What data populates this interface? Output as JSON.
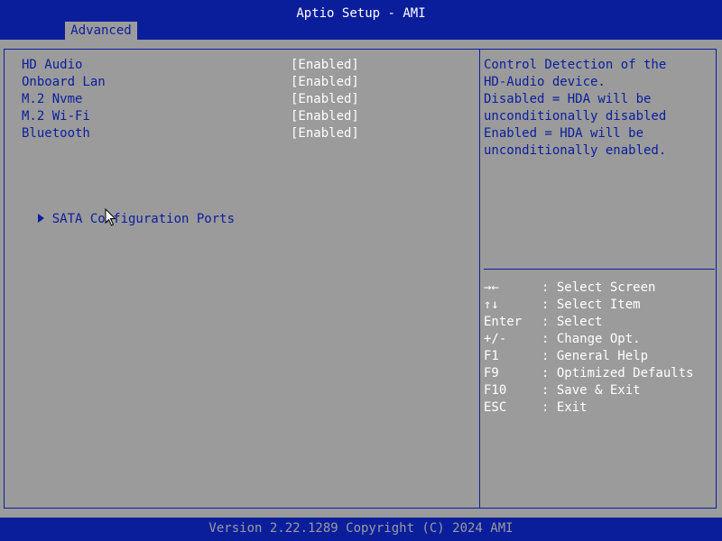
{
  "app_title": "Aptio Setup - AMI",
  "tabs": [
    {
      "label": "Advanced",
      "active": true
    }
  ],
  "settings": [
    {
      "label": "HD Audio",
      "value": "[Enabled]"
    },
    {
      "label": "Onboard Lan",
      "value": "[Enabled]"
    },
    {
      "label": "M.2 Nvme",
      "value": "[Enabled]"
    },
    {
      "label": "M.2 Wi-Fi",
      "value": "[Enabled]"
    },
    {
      "label": "Bluetooth",
      "value": "[Enabled]"
    }
  ],
  "submenus": [
    {
      "label": "SATA Configuration Ports"
    }
  ],
  "help": {
    "lines": [
      "Control Detection of the",
      "HD-Audio device.",
      "Disabled = HDA will be",
      "unconditionally disabled",
      "Enabled = HDA will be",
      "unconditionally enabled."
    ]
  },
  "key_legend": [
    {
      "key": "→←",
      "desc": ": Select Screen"
    },
    {
      "key": "↑↓",
      "desc": ": Select Item"
    },
    {
      "key": "Enter",
      "desc": ": Select"
    },
    {
      "key": "+/-",
      "desc": ": Change Opt."
    },
    {
      "key": "F1",
      "desc": ": General Help"
    },
    {
      "key": "F9",
      "desc": ": Optimized Defaults"
    },
    {
      "key": "F10",
      "desc": ": Save & Exit"
    },
    {
      "key": "ESC",
      "desc": ": Exit"
    }
  ],
  "footer": "Version 2.22.1289 Copyright (C) 2024 AMI",
  "colors": {
    "bios_blue": "#0a1e9c",
    "panel_gray": "#9b9b9b",
    "text_white": "#ffffff"
  },
  "icons": {
    "submenu": "triangle-right-icon",
    "cursor": "mouse-pointer-icon"
  }
}
